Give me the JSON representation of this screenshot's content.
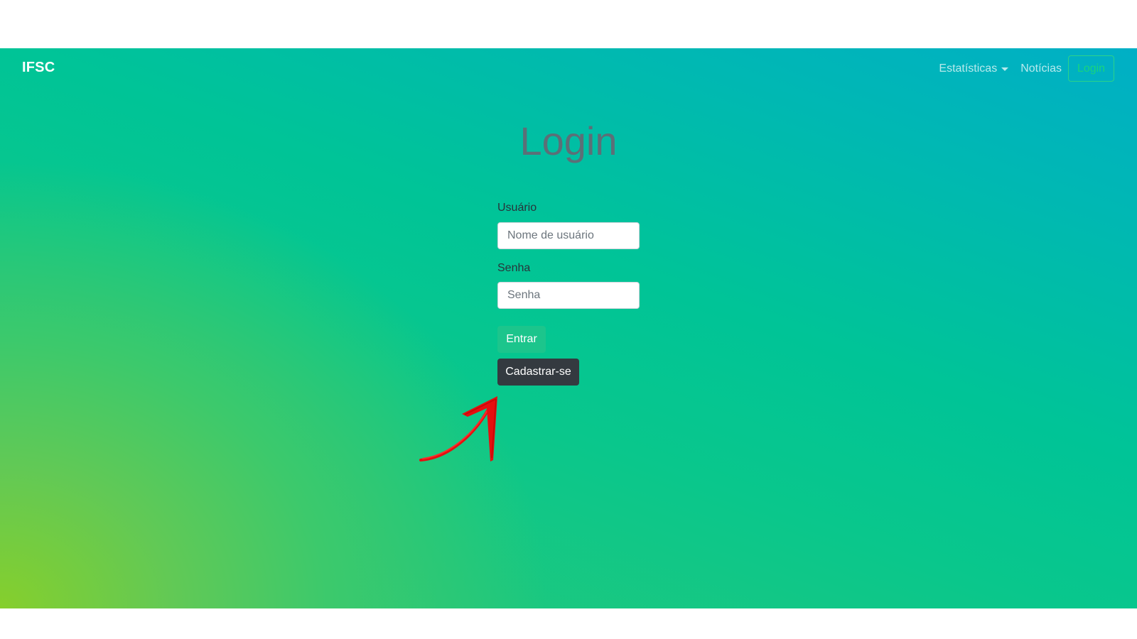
{
  "navbar": {
    "brand": "IFSC",
    "links": {
      "estatisticas": "Estatísticas",
      "noticias": "Notícias",
      "login": "Login"
    }
  },
  "form": {
    "title": "Login",
    "username_label": "Usuário",
    "username_placeholder": "Nome de usuário",
    "username_value": "",
    "password_label": "Senha",
    "password_placeholder": "Senha",
    "password_value": "",
    "submit_label": "Entrar",
    "register_label": "Cadastrar-se"
  },
  "annotation": {
    "arrow_icon": "red-hand-drawn-arrow",
    "arrow_color": "#e60f0f"
  },
  "colors": {
    "gradient_top_right": "#00afc6",
    "gradient_middle": "#00c497",
    "gradient_bottom_left": "#86cf2c",
    "submit_button": "#1cc58c",
    "register_button": "#343a40"
  }
}
